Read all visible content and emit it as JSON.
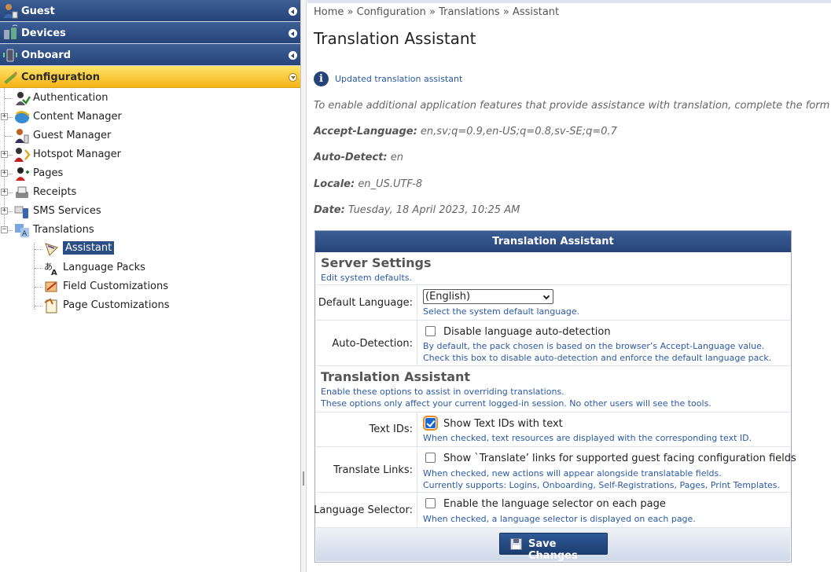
{
  "sidebar": {
    "headers": [
      {
        "label": "Guest",
        "icon": "guest-icon"
      },
      {
        "label": "Devices",
        "icon": "devices-icon"
      },
      {
        "label": "Onboard",
        "icon": "onboard-icon"
      },
      {
        "label": "Configuration",
        "icon": "configuration-icon"
      }
    ],
    "tree": [
      {
        "label": "Authentication",
        "icon": "authentication-icon",
        "expander": ""
      },
      {
        "label": "Content Manager",
        "icon": "content-manager-icon",
        "expander": "+"
      },
      {
        "label": "Guest Manager",
        "icon": "guest-manager-icon",
        "expander": ""
      },
      {
        "label": "Hotspot Manager",
        "icon": "hotspot-manager-icon",
        "expander": "+"
      },
      {
        "label": "Pages",
        "icon": "pages-icon",
        "expander": "+"
      },
      {
        "label": "Receipts",
        "icon": "receipts-icon",
        "expander": "+"
      },
      {
        "label": "SMS Services",
        "icon": "sms-services-icon",
        "expander": "+"
      },
      {
        "label": "Translations",
        "icon": "translations-icon",
        "expander": "−"
      }
    ],
    "subtree": [
      {
        "label": "Assistant",
        "icon": "assistant-icon",
        "selected": true
      },
      {
        "label": "Language Packs",
        "icon": "language-packs-icon",
        "selected": false
      },
      {
        "label": "Field Customizations",
        "icon": "field-customizations-icon",
        "selected": false
      },
      {
        "label": "Page Customizations",
        "icon": "page-customizations-icon",
        "selected": false
      }
    ]
  },
  "breadcrumb": {
    "items": [
      "Home",
      "Configuration",
      "Translations",
      "Assistant"
    ],
    "separator": "»"
  },
  "page_title": "Translation Assistant",
  "info": {
    "icon": "info-icon",
    "text": "Updated translation assistant"
  },
  "intro": "To enable additional application features that provide assistance with translation, complete the form below.",
  "meta": {
    "accept_language_label": "Accept-Language:",
    "accept_language_value": "en,sv;q=0.9,en-US;q=0.8,sv-SE;q=0.7",
    "auto_detect_label": "Auto-Detect:",
    "auto_detect_value": "en",
    "locale_label": "Locale:",
    "locale_value": "en_US.UTF-8",
    "date_label": "Date:",
    "date_value": "Tuesday, 18 April 2023, 10:25 AM"
  },
  "form": {
    "title": "Translation Assistant",
    "server_settings": {
      "heading": "Server Settings",
      "description": "Edit system defaults."
    },
    "default_language": {
      "label": "Default Language:",
      "value": "(English)",
      "hint": "Select the system default language."
    },
    "auto_detection": {
      "label": "Auto-Detection:",
      "checkbox_label": "Disable language auto-detection",
      "checked": false,
      "hint1": "By default, the pack chosen is based on the browser’s Accept-Language value.",
      "hint2": "Check this box to disable auto-detection and enforce the default language pack."
    },
    "assistant_section": {
      "heading": "Translation Assistant",
      "description1": "Enable these options to assist in overriding translations.",
      "description2": "These options only affect your current logged-in session. No other users will see the tools."
    },
    "text_ids": {
      "label": "Text IDs:",
      "checkbox_label": "Show Text IDs with text",
      "checked": true,
      "hint": "When checked, text resources are displayed with the corresponding text ID."
    },
    "translate_links": {
      "label": "Translate Links:",
      "checkbox_label": "Show `Translate’ links for supported guest facing configuration fields",
      "checked": false,
      "hint1": "When checked, new actions will appear alongside translatable fields.",
      "hint2": "Currently supports: Logins, Onboarding, Self-Registrations, Pages, Print Templates."
    },
    "language_selector": {
      "label": "Language Selector:",
      "checkbox_label": "Enable the language selector on each page",
      "checked": false,
      "hint": "When checked, a language selector is displayed on each page."
    },
    "save_label": "Save Changes",
    "save_icon": "save-disk-icon"
  },
  "colors": {
    "nav_header": "#24447a",
    "nav_active": "#f5b316",
    "hint_text": "#2a5aa5",
    "selected_item": "#2a4e86"
  }
}
